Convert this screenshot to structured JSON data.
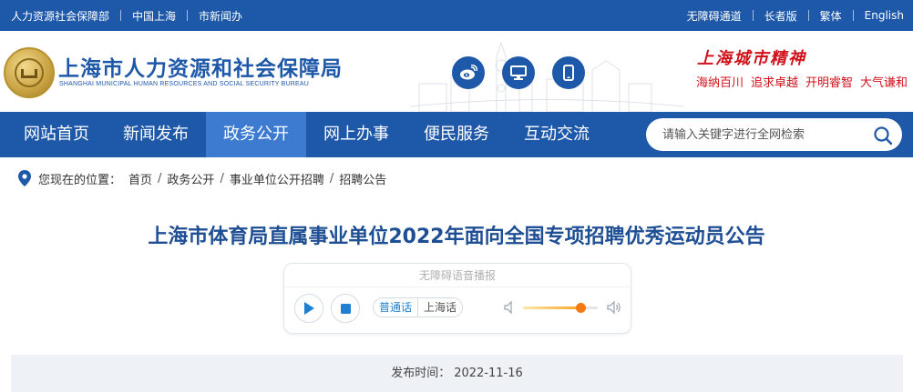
{
  "topbar": {
    "left_links": [
      "人力资源社会保障部",
      "中国上海",
      "市新闻办"
    ],
    "right_links": [
      "无障碍通道",
      "长者版",
      "繁体",
      "English"
    ]
  },
  "header": {
    "title": "上海市人力资源和社会保障局",
    "subtitle": "SHANGHAI MUNICIPAL HUMAN RESOURCES AND SOCIAL SECURITY BUREAU",
    "social_icons": [
      "weibo-icon",
      "desktop-icon",
      "mobile-icon"
    ],
    "motto_title": "上海城市精神",
    "motto_items": [
      "海纳百川",
      "追求卓越",
      "开明睿智",
      "大气谦和"
    ]
  },
  "nav": {
    "items": [
      "网站首页",
      "新闻发布",
      "政务公开",
      "网上办事",
      "便民服务",
      "互动交流"
    ],
    "active_index": 2,
    "search_placeholder": "请输入关键字进行全网检索"
  },
  "breadcrumb": {
    "label": "您现在的位置：",
    "items": [
      "首页",
      "政务公开",
      "事业单位公开招聘",
      "招聘公告"
    ]
  },
  "article": {
    "title": "上海市体育局直属事业单位2022年面向全国专项招聘优秀运动员公告",
    "player": {
      "title": "无障碍语音播报",
      "lang_selected": "普通话",
      "lang_other": "上海话",
      "volume": 0.77
    },
    "publish_label": "发布时间：",
    "publish_date": "2022-11-16"
  },
  "colors": {
    "primary": "#1e58a8",
    "nav_active": "#3d7bd0",
    "motto": "#d0121b",
    "title": "#1e4f94"
  }
}
